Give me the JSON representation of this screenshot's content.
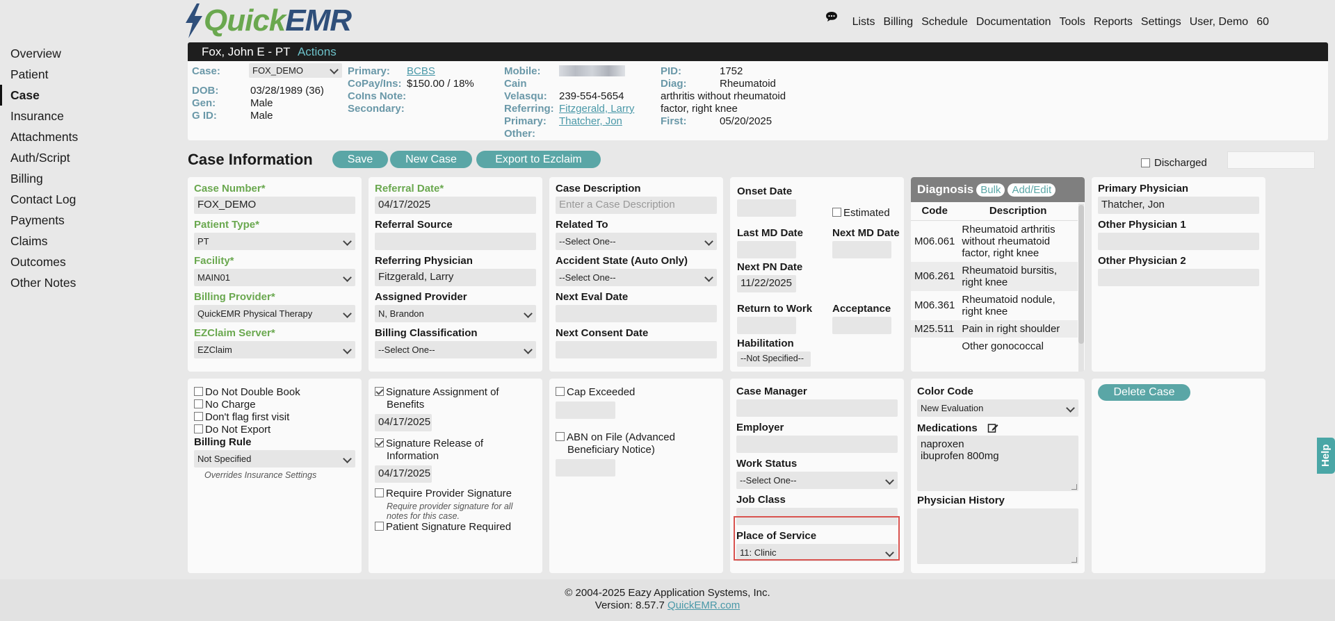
{
  "brand": {
    "quick": "Quick",
    "emr": "EMR"
  },
  "topnav": [
    "Lists",
    "Billing",
    "Schedule",
    "Documentation",
    "Tools",
    "Reports",
    "Settings",
    "User, Demo",
    "60"
  ],
  "sidebar": [
    "Overview",
    "Patient",
    "Case",
    "Insurance",
    "Attachments",
    "Auth/Script",
    "Billing",
    "Contact Log",
    "Payments",
    "Claims",
    "Outcomes",
    "Other Notes"
  ],
  "patient": {
    "name": "Fox, John E - PT",
    "actions": "Actions",
    "case_label": "Case:",
    "case_value": "FOX_DEMO",
    "dob_label": "DOB:",
    "dob_value": "03/28/1989 (36)",
    "gen_label": "Gen:",
    "gen_value": "Male",
    "gid_label": "G ID:",
    "gid_value": "Male",
    "primary_label": "Primary:",
    "primary_value": "BCBS",
    "copay_label": "CoPay/Ins:",
    "copay_value": "$150.00 / 18%",
    "coins_label": "CoIns Note:",
    "secondary_label": "Secondary:",
    "mobile_label": "Mobile:",
    "cain_label": "Cain",
    "velasqu_label": "Velasqu:",
    "velasqu_value": "239-554-5654",
    "referring_label": "Referring:",
    "referring_value": "Fitzgerald, Larry",
    "primary2_label": "Primary:",
    "primary2_value": "Thatcher, Jon",
    "other_label": "Other:",
    "pid_label": "PID:",
    "pid_value": "1752",
    "diag_label": "Diag:",
    "diag_value1": "Rheumatoid",
    "diag_value2": "arthritis without rheumatoid",
    "diag_value3": "factor, right knee",
    "first_label": "First:",
    "first_value": "05/20/2025"
  },
  "case_info": {
    "title": "Case Information",
    "save": "Save",
    "new_case": "New Case",
    "export": "Export to Ezclaim",
    "discharged": "Discharged"
  },
  "col1": {
    "case_number_label": "Case Number*",
    "case_number": "FOX_DEMO",
    "patient_type_label": "Patient Type*",
    "patient_type": "PT",
    "facility_label": "Facility*",
    "facility": "MAIN01",
    "billing_provider_label": "Billing Provider*",
    "billing_provider": "QuickEMR Physical Therapy",
    "ezclaim_label": "EZClaim Server*",
    "ezclaim": "EZClaim"
  },
  "col2": {
    "referral_date_label": "Referral Date*",
    "referral_date": "04/17/2025",
    "referral_source_label": "Referral Source",
    "referring_physician_label": "Referring Physician",
    "referring_physician": "Fitzgerald, Larry",
    "assigned_provider_label": "Assigned Provider",
    "assigned_provider": "N, Brandon",
    "billing_class_label": "Billing Classification",
    "billing_class": "--Select One--"
  },
  "col3": {
    "case_desc_label": "Case Description",
    "case_desc_placeholder": "Enter a Case Description",
    "related_to_label": "Related To",
    "related_to": "--Select One--",
    "accident_state_label": "Accident State (Auto Only)",
    "accident_state": "--Select One--",
    "next_eval_label": "Next Eval Date",
    "next_consent_label": "Next Consent Date"
  },
  "col4": {
    "onset_label": "Onset Date",
    "estimated": "Estimated",
    "last_md_label": "Last MD Date",
    "next_md_label": "Next MD Date",
    "next_pn_label": "Next PN Date",
    "next_pn": "11/22/2025",
    "return_work_label": "Return to Work",
    "acceptance_label": "Acceptance",
    "habilitation_label": "Habilitation",
    "habilitation": "--Not Specified--"
  },
  "diagnosis": {
    "title": "Diagnosis",
    "bulk": "Bulk",
    "add_edit": "Add/Edit",
    "col_code": "Code",
    "col_desc": "Description",
    "rows": [
      {
        "code": "M06.061",
        "desc": "Rheumatoid arthritis without rheumatoid factor, right knee"
      },
      {
        "code": "M06.261",
        "desc": "Rheumatoid bursitis, right knee"
      },
      {
        "code": "M06.361",
        "desc": "Rheumatoid nodule, right knee"
      },
      {
        "code": "M25.511",
        "desc": "Pain in right shoulder"
      },
      {
        "code": "",
        "desc": "Other gonococcal"
      }
    ]
  },
  "col6": {
    "primary_phys_label": "Primary Physician",
    "primary_phys": "Thatcher, Jon",
    "other_phys1_label": "Other Physician 1",
    "other_phys2_label": "Other Physician 2"
  },
  "bottom1": {
    "do_not_double_book": "Do Not Double Book",
    "no_charge": "No Charge",
    "dont_flag": "Don't flag first visit",
    "do_not_export": "Do Not Export",
    "billing_rule_label": "Billing Rule",
    "billing_rule": "Not Specified",
    "overrides_note": "Overrides Insurance Settings"
  },
  "bottom2": {
    "sig_assign_l1": "Signature Assignment of",
    "sig_assign_l2": "Benefits",
    "sig_assign_date": "04/17/2025",
    "sig_release_l1": "Signature Release of",
    "sig_release_l2": "Information",
    "sig_release_date": "04/17/2025",
    "require_provider_sig": "Require Provider Signature",
    "require_note_l1": "Require provider signature for all",
    "require_note_l2": "notes for this case.",
    "patient_sig_required": "Patient Signature Required"
  },
  "bottom3": {
    "cap_exceeded": "Cap Exceeded",
    "abn_l1": "ABN on File (Advanced",
    "abn_l2": "Beneficiary Notice)"
  },
  "bottom4": {
    "case_manager_label": "Case Manager",
    "employer_label": "Employer",
    "work_status_label": "Work Status",
    "work_status": "--Select One--",
    "job_class_label": "Job Class",
    "pos_label": "Place of Service",
    "pos": "11: Clinic"
  },
  "bottom5": {
    "color_code_label": "Color Code",
    "color_code": "New Evaluation",
    "medications_label": "Medications",
    "med1": "naproxen",
    "med2": "ibuprofen 800mg",
    "physician_history_label": "Physician History"
  },
  "bottom6": {
    "delete_case": "Delete Case"
  },
  "footer": {
    "copyright": "© 2004-2025 Eazy Application Systems, Inc.",
    "version_prefix": "Version: 8.57.7",
    "site": "QuickEMR.com"
  },
  "help": "Help"
}
